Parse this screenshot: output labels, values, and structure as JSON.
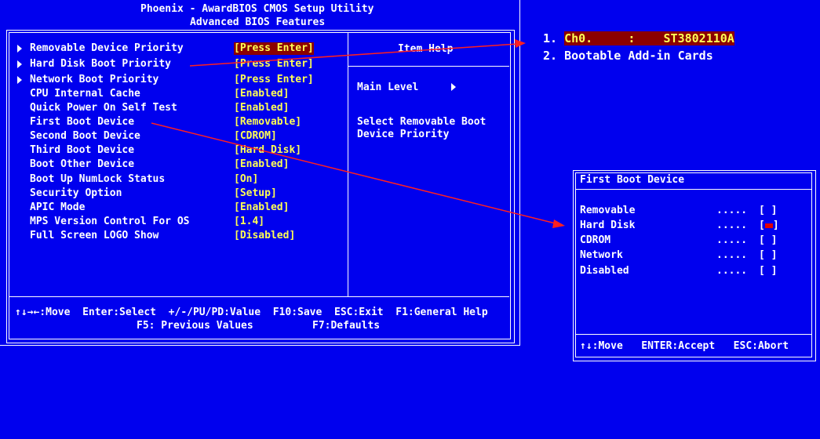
{
  "header": {
    "title": "Phoenix - AwardBIOS CMOS Setup Utility",
    "subtitle": "Advanced BIOS Features"
  },
  "settings": [
    {
      "label": "Removable Device Priority",
      "value": "[Press Enter]",
      "submenu": true
    },
    {
      "label": "Hard Disk Boot Priority",
      "value": "[Press Enter]",
      "submenu": true
    },
    {
      "label": "Network Boot Priority",
      "value": "[Press Enter]",
      "submenu": true
    },
    {
      "label": "CPU Internal Cache",
      "value": "[Enabled]"
    },
    {
      "label": "Quick Power On Self Test",
      "value": "[Enabled]"
    },
    {
      "label": "First Boot Device",
      "value": "[Removable]"
    },
    {
      "label": "Second Boot Device",
      "value": "[CDROM]"
    },
    {
      "label": "Third Boot Device",
      "value": "[Hard Disk]"
    },
    {
      "label": "Boot Other Device",
      "value": "[Enabled]"
    },
    {
      "label": "Boot Up NumLock Status",
      "value": "[On]"
    },
    {
      "label": "Security Option",
      "value": "[Setup]"
    },
    {
      "label": "APIC Mode",
      "value": "[Enabled]"
    },
    {
      "label": "MPS Version Control For OS",
      "value": "[1.4]"
    },
    {
      "label": "Full Screen LOGO Show",
      "value": "[Disabled]"
    }
  ],
  "item_help": {
    "title": "Item Help",
    "menu_level": "Main Level",
    "help_line1": "Select Removable Boot",
    "help_line2": "Device Priority"
  },
  "footer": {
    "line1": "↑↓→←:Move  Enter:Select  +/-/PU/PD:Value  F10:Save  ESC:Exit  F1:General Help",
    "f5": "F5: Previous Values",
    "f7": "F7:Defaults"
  },
  "hdd_priority": [
    {
      "num": "1.",
      "text": "Ch0.     :    ST3802110A"
    },
    {
      "num": "2.",
      "text": "Bootable Add-in Cards"
    }
  ],
  "popup": {
    "title": "First Boot Device",
    "options": [
      {
        "label": "Removable",
        "dots": ".....",
        "box": "[ ]",
        "selected": false
      },
      {
        "label": "Hard Disk",
        "dots": ".....",
        "box": "[ ]",
        "selected": true
      },
      {
        "label": "CDROM",
        "dots": ".....",
        "box": "[ ]",
        "selected": false
      },
      {
        "label": "Network",
        "dots": ".....",
        "box": "[ ]",
        "selected": false
      },
      {
        "label": "Disabled",
        "dots": ".....",
        "box": "[ ]",
        "selected": false
      }
    ],
    "footer": "↑↓:Move   ENTER:Accept   ESC:Abort"
  },
  "colors": {
    "background": "#0000ee",
    "value_text": "#ffff54",
    "highlight_bg": "#8b0000",
    "annotation_arrow": "#ff2020"
  }
}
